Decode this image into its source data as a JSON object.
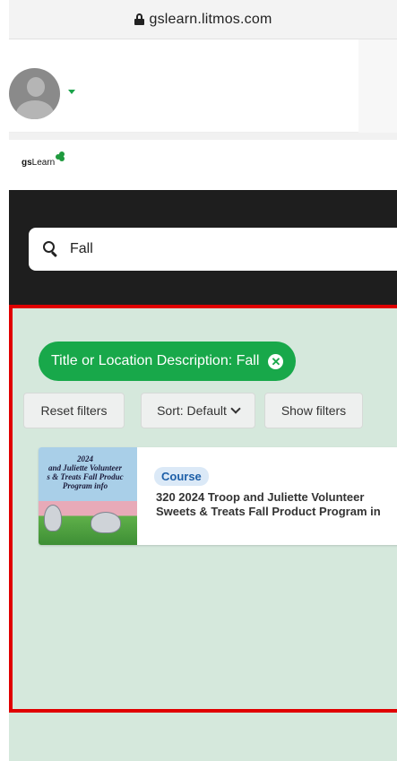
{
  "browser": {
    "url": "gslearn.litmos.com"
  },
  "brand": {
    "name_bold": "gs",
    "name_rest": "Learn",
    "leaf_color": "#1f9a3e"
  },
  "search": {
    "value": "Fall"
  },
  "filters": {
    "active_chip": "Title or Location Description: Fall",
    "reset_label": "Reset filters",
    "sort_label": "Sort: Default",
    "show_label": "Show filters"
  },
  "results": [
    {
      "type": "Course",
      "title_line1": "320 2024 Troop and Juliette Volunteer",
      "title_line2": "Sweets & Treats Fall Product Program in",
      "thumb_lines": [
        "2024",
        "and Juliette Volunteer",
        "s & Treats Fall Produc",
        "Program info"
      ]
    }
  ],
  "colors": {
    "chip_green": "#18a84a",
    "results_bg": "#d5e8dc",
    "highlight_border": "#e00000",
    "badge_text": "#1d5fa8",
    "search_band": "#1e1e1e"
  }
}
